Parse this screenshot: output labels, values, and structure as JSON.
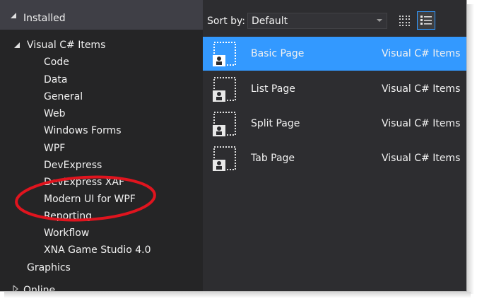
{
  "installed": {
    "label": "Installed"
  },
  "tree": {
    "root": "Visual C# Items",
    "children": [
      "Code",
      "Data",
      "General",
      "Web",
      "Windows Forms",
      "WPF",
      "DevExpress",
      "DevExpress XAF",
      "Modern UI for WPF",
      "Reporting",
      "Workflow",
      "XNA Game Studio 4.0"
    ],
    "sibling": "Graphics",
    "online": "Online"
  },
  "sort": {
    "label": "Sort by:",
    "value": "Default"
  },
  "templates": [
    {
      "name": "Basic Page",
      "lang": "Visual C# Items",
      "selected": true
    },
    {
      "name": "List Page",
      "lang": "Visual C# Items",
      "selected": false
    },
    {
      "name": "Split Page",
      "lang": "Visual C# Items",
      "selected": false
    },
    {
      "name": "Tab Page",
      "lang": "Visual C# Items",
      "selected": false
    }
  ],
  "colors": {
    "accent": "#3399ff",
    "annotation": "#e0141e",
    "background": "#2d2d30"
  },
  "icons": {
    "expand": "triangle-down-icon",
    "collapsed": "triangle-right-icon",
    "template": "page-template-icon",
    "small_icons_view": "grid-view-icon",
    "list_view": "list-view-icon"
  }
}
